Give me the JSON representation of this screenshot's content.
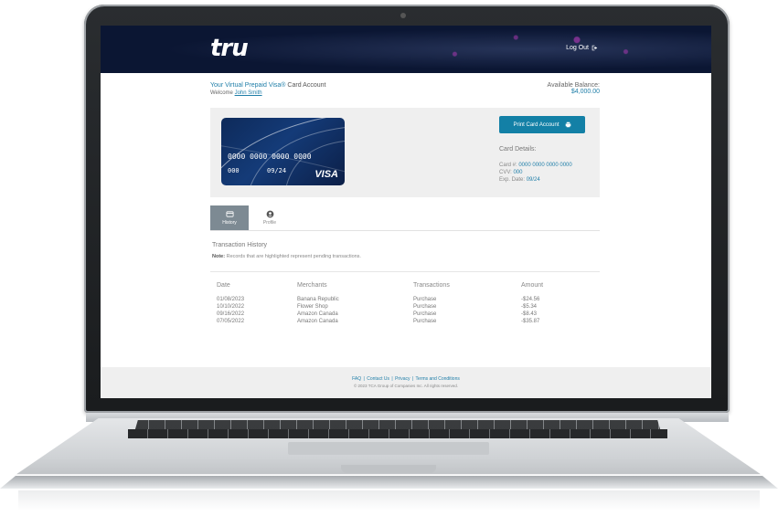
{
  "header": {
    "logo_text": "tru",
    "logout_label": "Log Out"
  },
  "account": {
    "title_brand": "Your Virtual Prepaid Visa®",
    "title_rest": " Card Account",
    "welcome_prefix": "Welcome ",
    "user_name": "John Smith",
    "balance_label": "Available Balance:",
    "balance_value": "$4,000.00"
  },
  "card": {
    "number": "0000 0000 0000 0000",
    "cvv": "000",
    "exp": "09/24",
    "network": "VISA"
  },
  "card_details": {
    "print_button": "Print Card Account",
    "title": "Card Details:",
    "number_label": "Card #: ",
    "number_value": "0000 0000 0000 0000",
    "cvv_label": "CVV: ",
    "cvv_value": "000",
    "exp_label": "Exp. Date: ",
    "exp_value": "09/24"
  },
  "tabs": [
    {
      "label": "History",
      "icon": "card-icon",
      "active": true
    },
    {
      "label": "Profile",
      "icon": "user-icon",
      "active": false
    }
  ],
  "history": {
    "title": "Transaction History",
    "note_label": "Note:",
    "note_text": " Records that are highlighted represent pending transactions.",
    "columns": [
      "Date",
      "Merchants",
      "Transactions",
      "Amount"
    ],
    "rows": [
      [
        "01/08/2023",
        "Banana Republic",
        "Purchase",
        "-$24.56"
      ],
      [
        "10/10/2022",
        "Flower Shop",
        "Purchase",
        "-$5.34"
      ],
      [
        "09/16/2022",
        "Amazon Canada",
        "Purchase",
        "-$8.43"
      ],
      [
        "07/05/2022",
        "Amazon Canada",
        "Purchase",
        "-$35.87"
      ]
    ]
  },
  "footer": {
    "faq": "FAQ",
    "contact": "Contact Us",
    "privacy": "Privacy",
    "terms": "Terms and Conditions",
    "copyright": "© 2023 TCA Group of Companies Inc. All rights reserved."
  },
  "colors": {
    "header_bg": "#0b1633",
    "accent": "#1380a6",
    "link": "#1f7ea8",
    "active_tab": "#7d8a93"
  }
}
